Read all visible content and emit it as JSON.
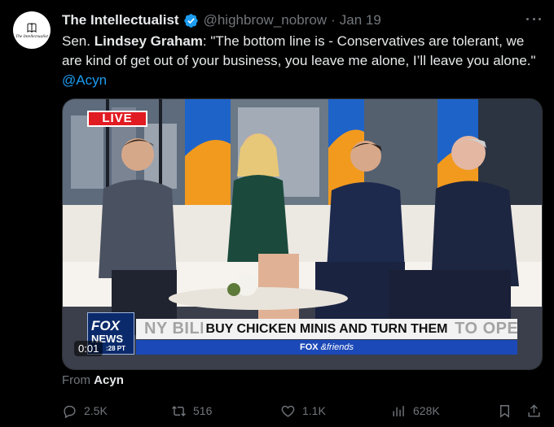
{
  "author": {
    "avatar_text": "The Intellectualist",
    "name": "The Intellectualist",
    "handle": "@highbrow_nobrow",
    "separator": "·",
    "date": "Jan 19"
  },
  "tweet": {
    "prefix": "Sen. ",
    "speaker": "Lindsey Graham",
    "body": ": \"The bottom line is - Conservatives are tolerant, we are kind of get out of your business, you leave me alone, I’ll leave you alone.\" ",
    "mention": "@Acyn"
  },
  "media": {
    "live_badge": "LIVE",
    "caption": "BUY CHICKEN MINIS AND TURN THEM",
    "ghost_caption": "NY BILL WOULD FORCE CHICK-FIL-A TO OPEN ON SUNDAYS",
    "fox_logo_top": "FOX",
    "fox_logo_mid": "NEWS",
    "fox_logo_time": ":28 PT",
    "fox_band_brand": "FOX",
    "fox_band_show": "&friends",
    "timer": "0:01"
  },
  "source": {
    "label": "From ",
    "account": "Acyn"
  },
  "actions": {
    "replies": "2.5K",
    "reposts": "516",
    "likes": "1.1K",
    "views": "628K"
  },
  "colors": {
    "background": "#000000",
    "text": "#e7e9ea",
    "muted": "#71767b",
    "link": "#1d9bf0",
    "live": "#e11b22",
    "fox_blue": "#1c49b8"
  }
}
